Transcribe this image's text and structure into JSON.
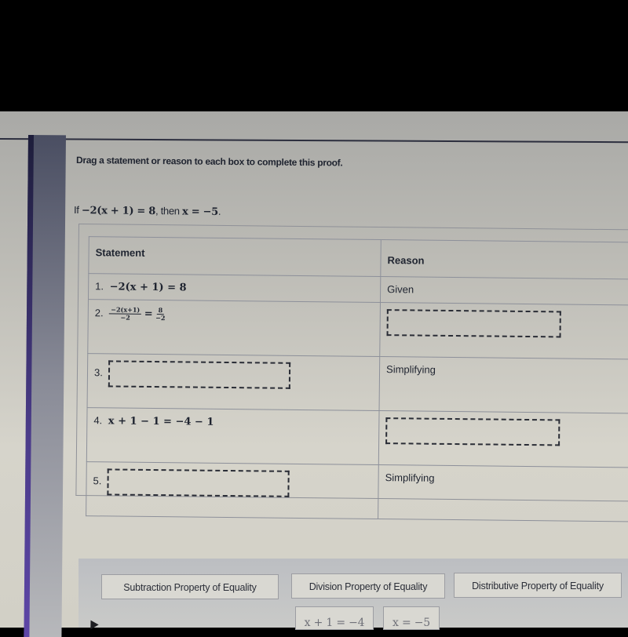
{
  "instructions": "Drag a statement or reason to each box to complete this proof.",
  "problem": {
    "prefix": "If ",
    "hypothesis": "−2(x + 1) = 8",
    "middle": ", then ",
    "conclusion": "x = −5",
    "suffix": "."
  },
  "table": {
    "headers": {
      "statement": "Statement",
      "reason": "Reason"
    },
    "rows": [
      {
        "number": "1.",
        "statement": "−2(x + 1) = 8",
        "reason": "Given",
        "statement_blank": false,
        "reason_blank": false
      },
      {
        "number": "2.",
        "statement_frac_left_num": "−2(x+1)",
        "statement_frac_left_den": "−2",
        "statement_eq": "=",
        "statement_frac_right_num": "8",
        "statement_frac_right_den": "−2",
        "reason": "",
        "statement_blank": false,
        "reason_blank": true
      },
      {
        "number": "3.",
        "statement": "",
        "reason": "Simplifying",
        "statement_blank": true,
        "reason_blank": false
      },
      {
        "number": "4.",
        "statement": "x + 1 − 1 = −4 − 1",
        "reason": "",
        "statement_blank": false,
        "reason_blank": true
      },
      {
        "number": "5.",
        "statement": "",
        "reason": "Simplifying",
        "statement_blank": true,
        "reason_blank": false
      }
    ]
  },
  "answer_tiles": [
    {
      "label": "Subtraction Property of Equality",
      "kind": "reason"
    },
    {
      "label": "Division Property of Equality",
      "kind": "reason"
    },
    {
      "label": "Distributive Property of Equality",
      "kind": "reason"
    },
    {
      "label": "x + 1 = −4",
      "kind": "statement"
    },
    {
      "label": "x = −5",
      "kind": "statement"
    }
  ],
  "colors": {
    "screen_bg": "#c9c8c0",
    "text": "#1f2430",
    "side_accent": "#5d45a6",
    "dashed_border": "#2a2d36"
  }
}
